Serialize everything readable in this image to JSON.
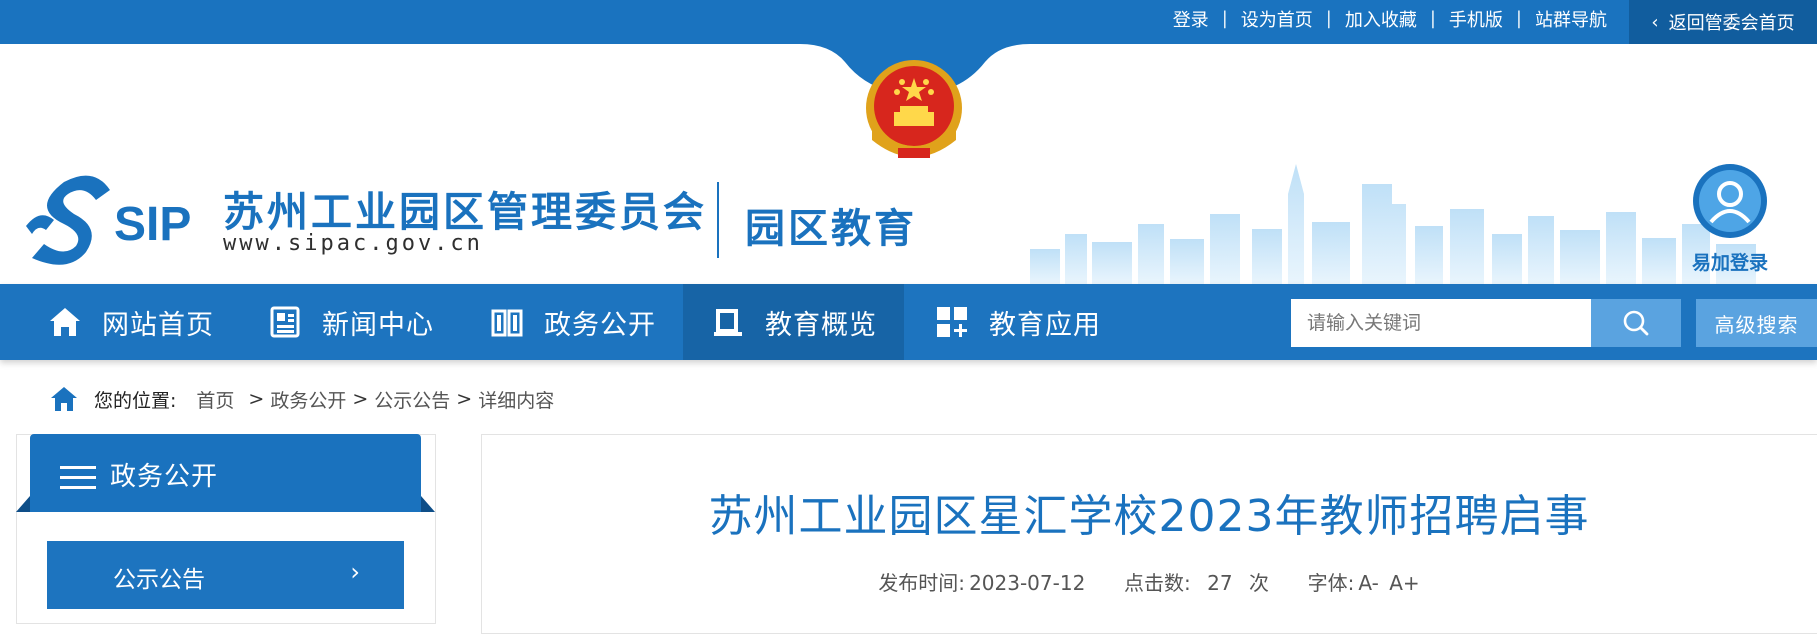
{
  "topbar": {
    "links": [
      "登录",
      "设为首页",
      "加入收藏",
      "手机版",
      "站群导航"
    ],
    "back_label": "返回管委会首页"
  },
  "header": {
    "logo_text": "SIP",
    "org_title": "苏州工业园区管理委员会",
    "org_url": "www.sipac.gov.cn",
    "sub_title": "园区教育",
    "login_label": "易加登录"
  },
  "nav": {
    "items": [
      {
        "label": "网站首页",
        "icon": "home-icon"
      },
      {
        "label": "新闻中心",
        "icon": "news-icon"
      },
      {
        "label": "政务公开",
        "icon": "book-icon"
      },
      {
        "label": "教育概览",
        "icon": "overview-icon"
      },
      {
        "label": "教育应用",
        "icon": "apps-icon"
      }
    ],
    "active_index": 3,
    "search_placeholder": "请输入关键词",
    "advanced_search_label": "高级搜索"
  },
  "breadcrumb": {
    "prefix": "您的位置:",
    "items": [
      "首页",
      "政务公开",
      "公示公告",
      "详细内容"
    ],
    "separator": ">"
  },
  "sidebar": {
    "title": "政务公开",
    "items": [
      {
        "label": "公示公告"
      }
    ]
  },
  "article": {
    "title": "苏州工业园区星汇学校2023年教师招聘启事",
    "publish_label": "发布时间:",
    "publish_date": "2023-07-12",
    "clicks_label": "点击数:",
    "clicks": "27",
    "clicks_unit": "次",
    "font_label": "字体:",
    "font_smaller": "A-",
    "font_larger": "A+"
  },
  "colors": {
    "primary": "#1a72be",
    "nav_bg": "#1d74bf",
    "nav_active": "#1764a6",
    "search_btn": "#5aa3e0"
  }
}
